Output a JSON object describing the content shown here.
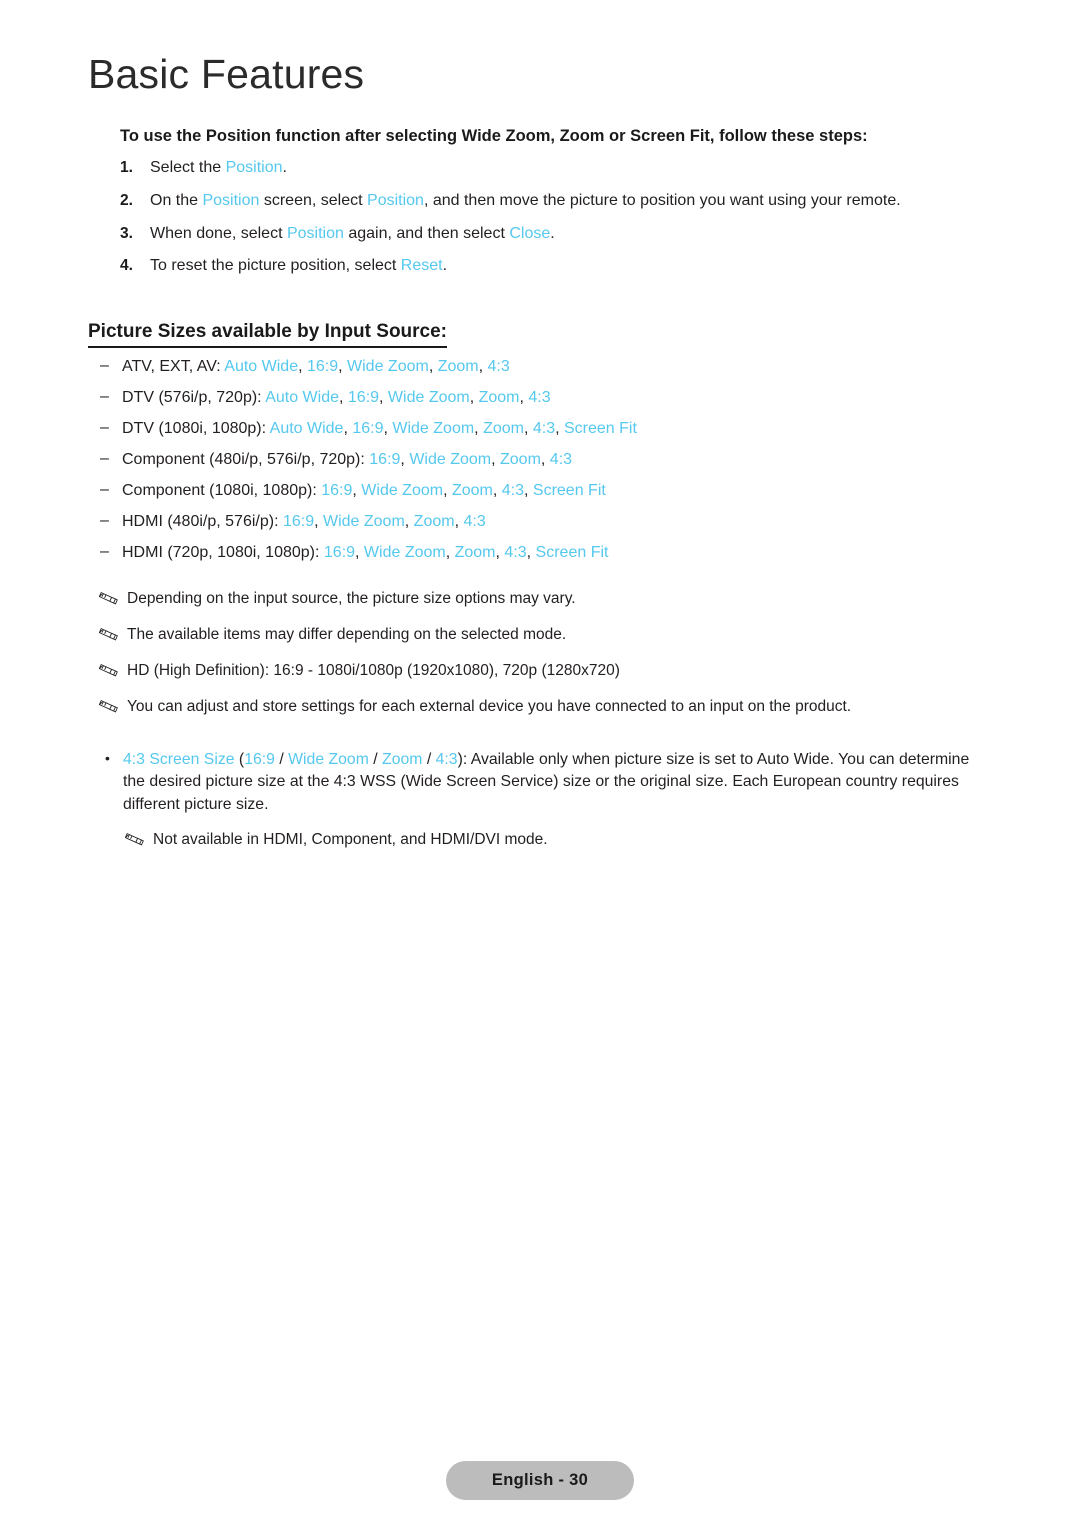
{
  "chapter": {
    "title": "Basic Features"
  },
  "intro": {
    "text": "To use the Position function after selecting Wide Zoom, Zoom or Screen Fit, follow these steps:"
  },
  "steps": [
    {
      "num": "1.",
      "parts": [
        {
          "t": "Select the ",
          "link": false
        },
        {
          "t": "Position",
          "link": true
        },
        {
          "t": ".",
          "link": false
        }
      ]
    },
    {
      "num": "2.",
      "parts": [
        {
          "t": "On the ",
          "link": false
        },
        {
          "t": "Position",
          "link": true
        },
        {
          "t": " screen, select ",
          "link": false
        },
        {
          "t": "Position",
          "link": true
        },
        {
          "t": ", and then move the picture to position you want using your remote.",
          "link": false
        }
      ]
    },
    {
      "num": "3.",
      "parts": [
        {
          "t": "When done, select ",
          "link": false
        },
        {
          "t": "Position",
          "link": true
        },
        {
          "t": " again, and then select ",
          "link": false
        },
        {
          "t": "Close",
          "link": true
        },
        {
          "t": ".",
          "link": false
        }
      ]
    },
    {
      "num": "4.",
      "parts": [
        {
          "t": "To reset the picture position, select ",
          "link": false
        },
        {
          "t": "Reset",
          "link": true
        },
        {
          "t": ".",
          "link": false
        }
      ]
    }
  ],
  "section_heading": "Picture Sizes available by Input Source:",
  "dash_items": [
    {
      "dash": "–",
      "parts": [
        {
          "t": "ATV, EXT, AV: ",
          "link": false
        },
        {
          "t": "Auto Wide",
          "link": true
        },
        {
          "t": ", ",
          "link": false
        },
        {
          "t": "16:9",
          "link": true
        },
        {
          "t": ", ",
          "link": false
        },
        {
          "t": "Wide Zoom",
          "link": true
        },
        {
          "t": ", ",
          "link": false
        },
        {
          "t": "Zoom",
          "link": true
        },
        {
          "t": ", ",
          "link": false
        },
        {
          "t": "4:3",
          "link": true
        }
      ]
    },
    {
      "dash": "–",
      "parts": [
        {
          "t": "DTV (576i/p, 720p): ",
          "link": false
        },
        {
          "t": "Auto Wide",
          "link": true
        },
        {
          "t": ", ",
          "link": false
        },
        {
          "t": "16:9",
          "link": true
        },
        {
          "t": ", ",
          "link": false
        },
        {
          "t": "Wide Zoom",
          "link": true
        },
        {
          "t": ", ",
          "link": false
        },
        {
          "t": "Zoom",
          "link": true
        },
        {
          "t": ", ",
          "link": false
        },
        {
          "t": "4:3",
          "link": true
        }
      ]
    },
    {
      "dash": "–",
      "parts": [
        {
          "t": "DTV (1080i, 1080p): ",
          "link": false
        },
        {
          "t": "Auto Wide",
          "link": true
        },
        {
          "t": ", ",
          "link": false
        },
        {
          "t": "16:9",
          "link": true
        },
        {
          "t": ", ",
          "link": false
        },
        {
          "t": "Wide Zoom",
          "link": true
        },
        {
          "t": ", ",
          "link": false
        },
        {
          "t": "Zoom",
          "link": true
        },
        {
          "t": ", ",
          "link": false
        },
        {
          "t": "4:3",
          "link": true
        },
        {
          "t": ", ",
          "link": false
        },
        {
          "t": "Screen Fit",
          "link": true
        }
      ]
    },
    {
      "dash": "–",
      "parts": [
        {
          "t": "Component (480i/p, 576i/p, 720p): ",
          "link": false
        },
        {
          "t": "16:9",
          "link": true
        },
        {
          "t": ", ",
          "link": false
        },
        {
          "t": "Wide Zoom",
          "link": true
        },
        {
          "t": ", ",
          "link": false
        },
        {
          "t": "Zoom",
          "link": true
        },
        {
          "t": ", ",
          "link": false
        },
        {
          "t": "4:3",
          "link": true
        }
      ]
    },
    {
      "dash": "–",
      "parts": [
        {
          "t": "Component (1080i, 1080p): ",
          "link": false
        },
        {
          "t": "16:9",
          "link": true
        },
        {
          "t": ", ",
          "link": false
        },
        {
          "t": "Wide Zoom",
          "link": true
        },
        {
          "t": ", ",
          "link": false
        },
        {
          "t": "Zoom",
          "link": true
        },
        {
          "t": ", ",
          "link": false
        },
        {
          "t": "4:3",
          "link": true
        },
        {
          "t": ", ",
          "link": false
        },
        {
          "t": "Screen Fit",
          "link": true
        }
      ]
    },
    {
      "dash": "–",
      "parts": [
        {
          "t": "HDMI (480i/p, 576i/p): ",
          "link": false
        },
        {
          "t": "16:9",
          "link": true
        },
        {
          "t": ", ",
          "link": false
        },
        {
          "t": "Wide Zoom",
          "link": true
        },
        {
          "t": ", ",
          "link": false
        },
        {
          "t": "Zoom",
          "link": true
        },
        {
          "t": ", ",
          "link": false
        },
        {
          "t": "4:3",
          "link": true
        }
      ]
    },
    {
      "dash": "–",
      "parts": [
        {
          "t": "HDMI (720p, 1080i, 1080p): ",
          "link": false
        },
        {
          "t": "16:9",
          "link": true
        },
        {
          "t": ", ",
          "link": false
        },
        {
          "t": "Wide Zoom",
          "link": true
        },
        {
          "t": ", ",
          "link": false
        },
        {
          "t": "Zoom",
          "link": true
        },
        {
          "t": ", ",
          "link": false
        },
        {
          "t": "4:3",
          "link": true
        },
        {
          "t": ", ",
          "link": false
        },
        {
          "t": "Screen Fit",
          "link": true
        }
      ]
    }
  ],
  "notes": [
    {
      "icon": "pencil-note-icon",
      "text": "Depending on the input source, the picture size options may vary."
    },
    {
      "icon": "pencil-note-icon",
      "text": "The available items may differ depending on the selected mode."
    },
    {
      "icon": "pencil-note-icon",
      "text": "HD (High Definition): 16:9 - 1080i/1080p (1920x1080), 720p (1280x720)"
    },
    {
      "icon": "pencil-note-icon",
      "text": "You can adjust and store settings for each external device you have connected to an input on the product."
    }
  ],
  "bullet_block": {
    "dot": "•",
    "parts": [
      {
        "t": "4:3 Screen Size",
        "link": true
      },
      {
        "t": " (",
        "link": false
      },
      {
        "t": "16:9",
        "link": true
      },
      {
        "t": " / ",
        "link": false
      },
      {
        "t": "Wide Zoom",
        "link": true
      },
      {
        "t": " / ",
        "link": false
      },
      {
        "t": "Zoom",
        "link": true
      },
      {
        "t": " / ",
        "link": false
      },
      {
        "t": "4:3",
        "link": true
      },
      {
        "t": "): Available only when picture size is set to Auto Wide. You can determine the desired picture size at the 4:3 WSS (Wide Screen Service) size or the original size. Each European country requires different picture size.",
        "link": false
      }
    ],
    "subnote": {
      "icon": "pencil-note-icon",
      "text": "Not available in HDMI, Component, and HDMI/DVI mode."
    }
  },
  "footer": {
    "page_label": "English - 30"
  },
  "colors": {
    "link": "#55c8ee",
    "text": "#231f20",
    "footer_pill": "#bcbcbc"
  }
}
